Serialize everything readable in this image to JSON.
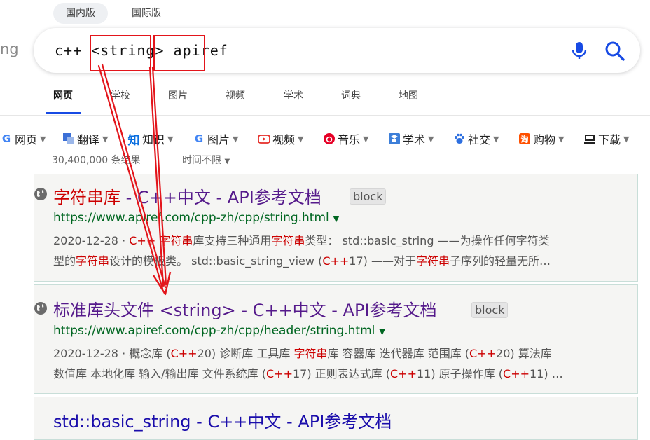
{
  "locale_tabs": [
    {
      "label": "国内版",
      "active": true
    },
    {
      "label": "国际版",
      "active": false
    }
  ],
  "brand_fragment": "ng",
  "search": {
    "query_prefix": "c++ ",
    "query_mid": "<string>",
    "query_suffix": "apiref"
  },
  "scope_tabs": [
    {
      "label": "网页",
      "active": true
    },
    {
      "label": "学校"
    },
    {
      "label": "图片"
    },
    {
      "label": "视频"
    },
    {
      "label": "学术"
    },
    {
      "label": "词典"
    },
    {
      "label": "地图"
    }
  ],
  "filters": [
    {
      "label": "网页",
      "icon": "google-g-icon"
    },
    {
      "label": "翻译",
      "icon": "translate-icon"
    },
    {
      "label": "知识",
      "icon": "zhihu-icon"
    },
    {
      "label": "图片",
      "icon": "google-g-icon"
    },
    {
      "label": "视频",
      "icon": "youtube-icon"
    },
    {
      "label": "音乐",
      "icon": "netease-music-icon"
    },
    {
      "label": "学术",
      "icon": "scholar-icon"
    },
    {
      "label": "社交",
      "icon": "baidu-paw-icon"
    },
    {
      "label": "购物",
      "icon": "taobao-icon"
    },
    {
      "label": "下载",
      "icon": "download-icon"
    }
  ],
  "result_count": "30,400,000 条结果",
  "time_filter": "时间不限",
  "results": [
    {
      "title_hl": "字符串库",
      "title_rest": " - C++中文 - API参考文档",
      "block": "block",
      "url": "https://www.apiref.com/cpp-zh/cpp/string.html",
      "line1": [
        "2020-12-28 · ",
        "C++",
        " ",
        "字符串",
        "库支持三种通用",
        "字符串",
        "类型： std::basic_string ——为操作任何字符类"
      ],
      "line2": [
        "型的",
        "字符串",
        "设计的模板类。 std::basic_string_view (",
        "C++",
        "17) ——对于",
        "字符串",
        "子序列的轻量无所…"
      ]
    },
    {
      "title": "标准库头文件 <string> - C++中文 - API参考文档",
      "block": "block",
      "url": "https://www.apiref.com/cpp-zh/cpp/header/string.html",
      "line1": [
        "2020-12-28 · 概念库 (",
        "C++",
        "20) 诊断库 工具库 ",
        "字符串",
        "库 容器库 迭代器库 范围库 (",
        "C++",
        "20) 算法库"
      ],
      "line2": [
        "数值库 本地化库 输入/输出库 文件系统库 (",
        "C++",
        "17) 正则表达式库 (",
        "C++",
        "11) 原子操作库 (",
        "C++",
        "11) …"
      ]
    },
    {
      "title": "std::basic_string - C++中文 - API参考文档"
    }
  ],
  "colors": {
    "accent": "#174ae4",
    "highlight_red": "#e3151b",
    "link": "#551a8b",
    "url": "#006621"
  }
}
